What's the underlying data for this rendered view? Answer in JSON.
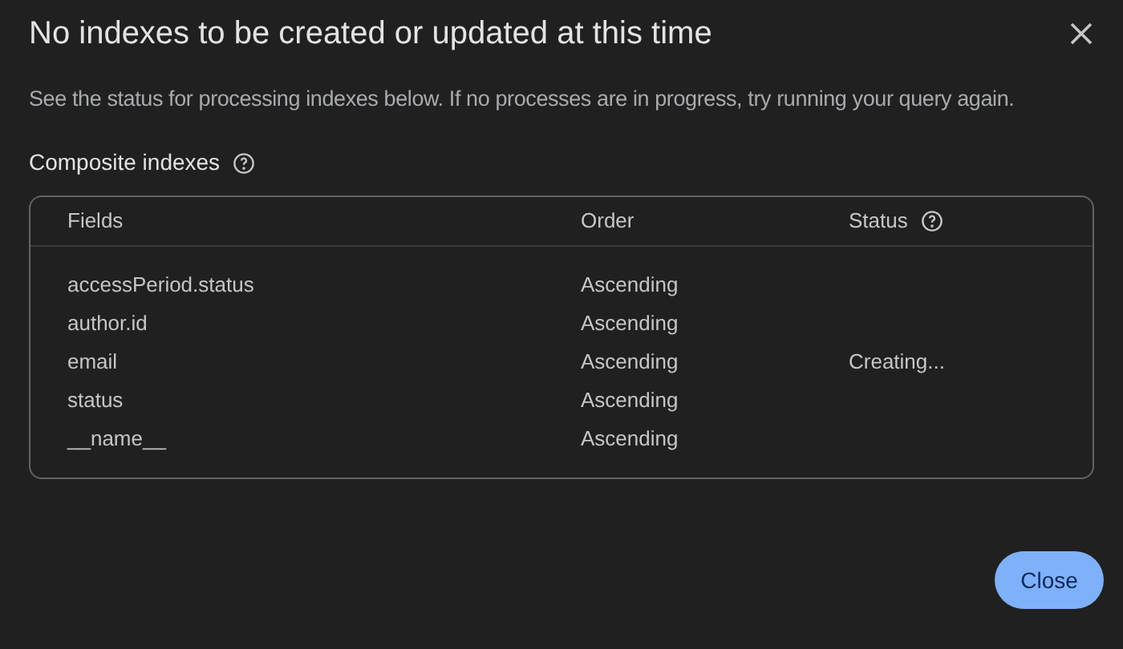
{
  "dialog": {
    "title": "No indexes to be created or updated at this time",
    "description": "See the status for processing indexes below. If no processes are in progress, try running your query again.",
    "section_title": "Composite indexes"
  },
  "table": {
    "columns": [
      "Fields",
      "Order",
      "Status"
    ],
    "rows": [
      {
        "field": "accessPeriod.status",
        "order": "Ascending"
      },
      {
        "field": "author.id",
        "order": "Ascending"
      },
      {
        "field": "email",
        "order": "Ascending",
        "status": "Creating..."
      },
      {
        "field": "status",
        "order": "Ascending"
      },
      {
        "field": "__name__",
        "order": "Ascending"
      }
    ]
  },
  "buttons": [
    "Close"
  ]
}
